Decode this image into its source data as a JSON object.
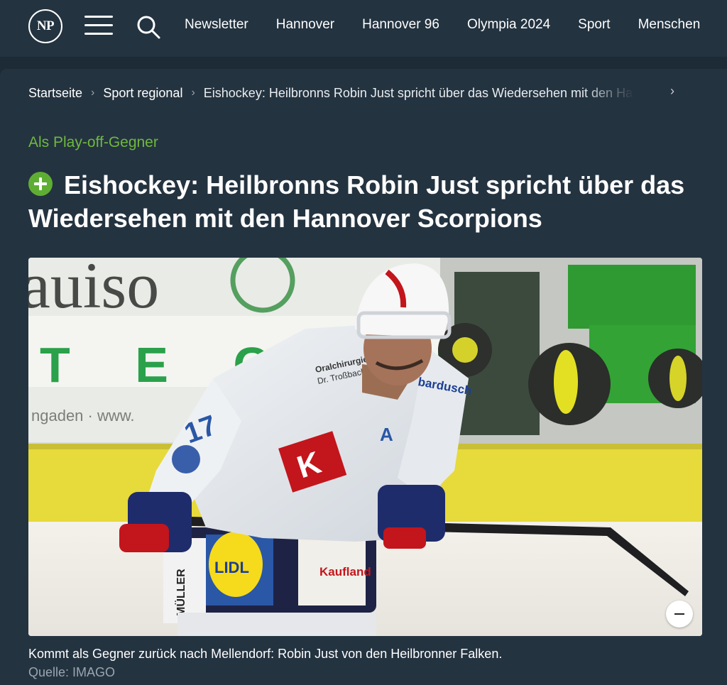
{
  "header": {
    "logo_text": "NP",
    "nav": [
      "Newsletter",
      "Hannover",
      "Hannover 96",
      "Olympia 2024",
      "Sport",
      "Menschen"
    ]
  },
  "breadcrumb": {
    "items": [
      "Startseite",
      "Sport regional"
    ],
    "current": "Eishockey: Heilbronns Robin Just spricht über das Wiedersehen mit den Hannover Scorpions"
  },
  "article": {
    "kicker": "Als Play-off-Gegner",
    "headline": "Eishockey: Heilbronns Robin Just spricht über das Wiedersehen mit den Hannover Scorpions",
    "caption": "Kommt als Gegner zurück nach Mellendorf: Robin Just von den Heilbronner Falken.",
    "source": "Quelle: IMAGO"
  },
  "image_text": {
    "jersey_number": "17",
    "jersey_letter": "A",
    "sponsor_lidl": "LIDL",
    "sponsor_kaufland": "Kaufland",
    "sponsor_mueller": "MÜLLER",
    "sponsor_bardusch": "bardusch",
    "sponsor_oralchirurgie": "Oralchirurgie",
    "sponsor_doctor": "Dr. Troßbach",
    "board_letters": "T E C H N",
    "board_partial": "ngaden · www."
  },
  "icons": {
    "plus": "plus-circle-icon",
    "menu": "hamburger-menu-icon",
    "search": "search-icon",
    "chevron": "chevron-right-icon",
    "zoom": "minus-icon"
  },
  "colors": {
    "background": "#1d2b36",
    "card": "#243340",
    "kicker": "#6fb83f",
    "plus_badge": "#5fae34"
  }
}
